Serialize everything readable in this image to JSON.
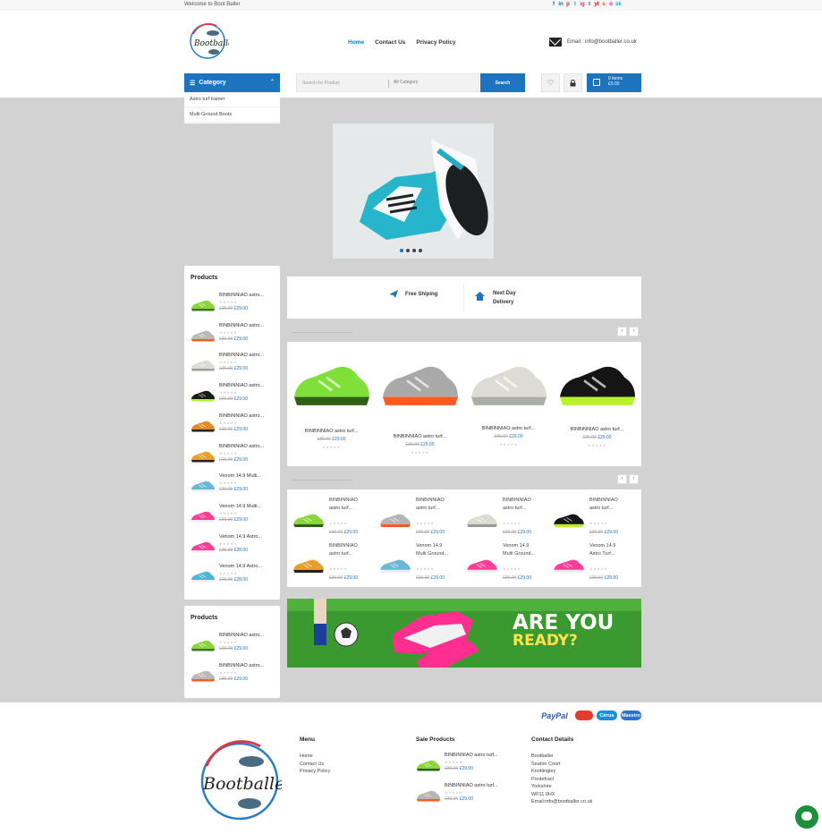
{
  "topbar": {
    "welcome": "Welcome to Boot Baller",
    "socials": [
      "f",
      "in",
      "p",
      "t",
      "ig",
      "t",
      "yt",
      "s",
      "o",
      "sk"
    ]
  },
  "nav": {
    "home": "Home",
    "contact": "Contact Us",
    "privacy": "Privacy Policy"
  },
  "header": {
    "email": "Email : info@bootballer.co.uk"
  },
  "category": {
    "label": "Category",
    "items": [
      "Astro turf trainer",
      "Multi Ground Boots"
    ]
  },
  "search": {
    "placeholder": "Search for Product",
    "category": "All Category",
    "button": "Search"
  },
  "cart": {
    "items": "0 items",
    "total": "£0.00"
  },
  "features": {
    "shipping": "Free Shiping",
    "delivery": "Next Day Delivery"
  },
  "sidebar": {
    "title": "Products",
    "items": [
      {
        "name": "BINBINNIAO astro...",
        "old": "£36.00",
        "price": "£29.00"
      },
      {
        "name": "BINBINNIAO astro...",
        "old": "£36.00",
        "price": "£29.00"
      },
      {
        "name": "BINBINNIAO astro...",
        "old": "£36.00",
        "price": "£29.00"
      },
      {
        "name": "BINBINNIAO astro...",
        "old": "£36.00",
        "price": "£29.00"
      },
      {
        "name": "BINBINNIAO astro...",
        "old": "£36.00",
        "price": "£29.00"
      },
      {
        "name": "BINBINNIAO astro...",
        "old": "£36.00",
        "price": "£29.00"
      },
      {
        "name": "Venom 14.9 Multi...",
        "old": "£36.00",
        "price": "£29.00"
      },
      {
        "name": "Venom 14.9 Multi...",
        "old": "£36.00",
        "price": "£29.00"
      },
      {
        "name": "Venom 14.9 Astro...",
        "old": "£35.00",
        "price": "£28.00"
      },
      {
        "name": "Venom 14.9 Astro...",
        "old": "£35.00",
        "price": "£28.00"
      }
    ],
    "title2": "Products",
    "items2": [
      {
        "name": "BINBINNIAO astro...",
        "old": "£36.00",
        "price": "£29.00"
      },
      {
        "name": "BINBINNIAO astro...",
        "old": "£36.00",
        "price": "£29.00"
      }
    ]
  },
  "featured": [
    {
      "name": "BINBINNIAO astro turf...",
      "old": "£36.00",
      "price": "£29.00"
    },
    {
      "name": "BINBINNIAO astro turf...",
      "old": "£36.00",
      "price": "£29.00"
    },
    {
      "name": "BINBINNIAO astro turf...",
      "old": "£36.00",
      "price": "£29.00"
    },
    {
      "name": "BINBINNIAO astro turf...",
      "old": "£36.00",
      "price": "£29.00"
    }
  ],
  "grid": [
    {
      "l1": "BINBINNIAO",
      "l2": "astro turf...",
      "old": "£36.00",
      "price": "£29.00"
    },
    {
      "l1": "BINBINNIAO",
      "l2": "astro turf...",
      "old": "£36.00",
      "price": "£29.00"
    },
    {
      "l1": "BINBINNIAO",
      "l2": "astro turf...",
      "old": "£36.00",
      "price": "£29.00"
    },
    {
      "l1": "BINBINNIAO",
      "l2": "astro turf...",
      "old": "£36.00",
      "price": "£29.00"
    },
    {
      "l1": "BINBINNIAO",
      "l2": "astro turf...",
      "old": "£36.00",
      "price": "£29.00"
    },
    {
      "l1": "Venom 14.9",
      "l2": "Multi Ground...",
      "old": "£36.00",
      "price": "£29.00"
    },
    {
      "l1": "Venom 14.9",
      "l2": "Multi Ground...",
      "old": "£36.00",
      "price": "£29.00"
    },
    {
      "l1": "Venom 14.9",
      "l2": "Astro Turf...",
      "old": "£35.00",
      "price": "£28.00"
    }
  ],
  "banner": {
    "line1": "ARE YOU",
    "line2": "READY?"
  },
  "payments": [
    "PayPal",
    "MC",
    "Cirrus",
    "Maestro"
  ],
  "footer": {
    "menu_title": "Menu",
    "menu": [
      "Home",
      "Contact Us",
      "Privacy Policy"
    ],
    "sale_title": "Sale Products",
    "sale": [
      {
        "name": "BINBINNIAO astro turf...",
        "old": "£36.00",
        "price": "£29.00"
      },
      {
        "name": "BINBINNIAO astro turf...",
        "old": "£36.00",
        "price": "£29.00"
      }
    ],
    "contact_title": "Contact Details",
    "contact": [
      "Bootballer",
      "Seaton Court",
      "Knottingley",
      "Pontefract",
      "Yorkshire",
      "WF11 0HX",
      "Email:info@bootballer.co.uk"
    ]
  },
  "logo_text": "Bootballer"
}
